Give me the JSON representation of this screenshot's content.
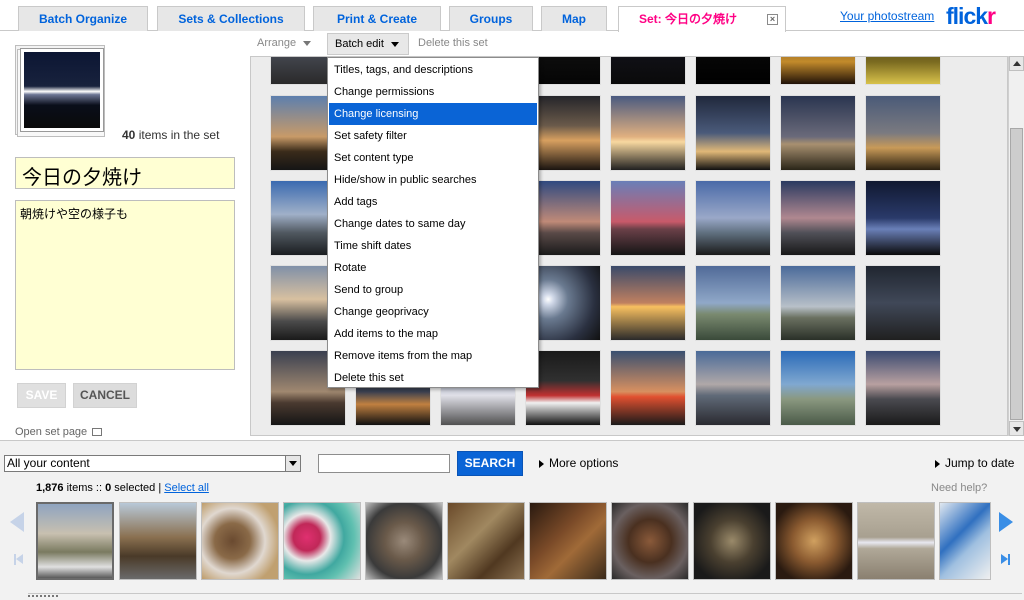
{
  "tabs": [
    {
      "label": "Batch Organize"
    },
    {
      "label": "Sets & Collections"
    },
    {
      "label": "Print & Create"
    },
    {
      "label": "Groups"
    },
    {
      "label": "Map"
    },
    {
      "label": "Set: 今日の夕焼け",
      "active": true
    }
  ],
  "header": {
    "photostream_link": "Your photostream",
    "logo_part1": "flick",
    "logo_part2": "r"
  },
  "set": {
    "item_count": "40",
    "items_label": "items in the set",
    "title": "今日の夕焼け",
    "description": "朝焼けや空の様子も",
    "save_label": "SAVE",
    "cancel_label": "CANCEL",
    "open_set_page": "Open set page"
  },
  "toolbar": {
    "arrange": "Arrange",
    "batch_edit": "Batch edit",
    "delete_set": "Delete this set"
  },
  "batch_menu": {
    "items": [
      "Titles, tags, and descriptions",
      "Change permissions",
      "Change licensing",
      "Set safety filter",
      "Set content type",
      "Hide/show in public searches",
      "Add tags",
      "Change dates to same day",
      "Time shift dates",
      "Rotate",
      "Send to group",
      "Change geoprivacy",
      "Add items to the map",
      "Remove items from the map",
      "Delete this set"
    ],
    "highlighted_index": 2
  },
  "bottom": {
    "content_filter": "All your content",
    "search_label": "SEARCH",
    "search_value": "",
    "more_options": "More options",
    "jump_to_date": "Jump to date",
    "items_total": "1,876",
    "items_word": "items ::",
    "selected_count": "0",
    "selected_word": "selected |",
    "select_all": "Select all",
    "need_help": "Need help?"
  },
  "colors": {
    "flickr_blue": "#0063dc",
    "flickr_pink": "#ff0084",
    "menu_highlight": "#0a64d6",
    "input_bg": "#ffffd3"
  }
}
